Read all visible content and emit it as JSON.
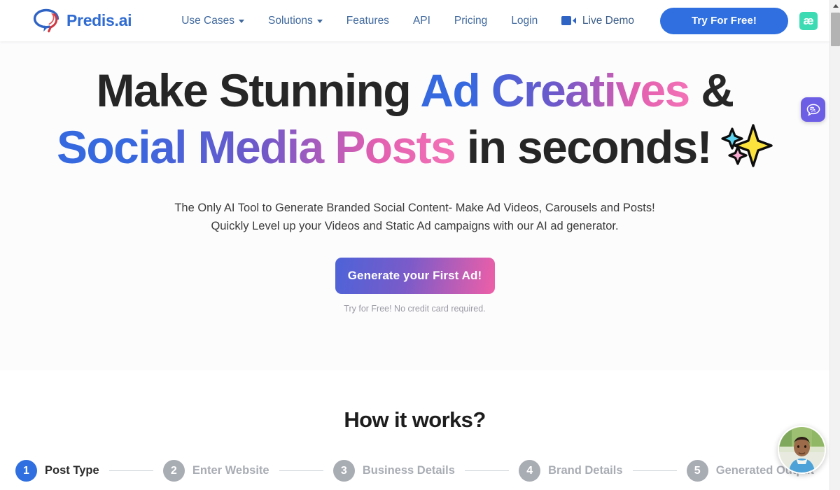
{
  "header": {
    "brand_name": "Predis.ai",
    "logo_icon": "predis-speech-bubble-logo",
    "nav": [
      {
        "label": "Use Cases",
        "has_caret": true
      },
      {
        "label": "Solutions",
        "has_caret": true
      },
      {
        "label": "Features",
        "has_caret": false
      },
      {
        "label": "API",
        "has_caret": false
      },
      {
        "label": "Pricing",
        "has_caret": false
      },
      {
        "label": "Login",
        "has_caret": false
      }
    ],
    "live_demo_label": "Live Demo",
    "live_demo_icon": "video-camera-icon",
    "try_free_label": "Try For Free!",
    "ae_badge_label": "æ"
  },
  "hero": {
    "headline_line1_plain": "Make Stunning ",
    "headline_line1_gradient": "Ad Creatives",
    "headline_line1_tail": " &",
    "headline_line2_gradient": "Social Media Posts",
    "headline_line2_plain": " in seconds!",
    "sparkle_icon": "sparkles-emoji",
    "subtitle_line1": "The Only AI Tool to Generate Branded Social Content- Make Ad Videos, Carousels and Posts!",
    "subtitle_line2": "Quickly Level up your Videos and Static Ad campaigns with our AI ad generator.",
    "cta_label": "Generate your First Ad!",
    "cta_note": "Try for Free! No credit card required."
  },
  "how_it_works": {
    "title": "How it works?",
    "steps": [
      {
        "number": "1",
        "label": "Post Type",
        "active": true
      },
      {
        "number": "2",
        "label": "Enter Website",
        "active": false
      },
      {
        "number": "3",
        "label": "Business Details",
        "active": false
      },
      {
        "number": "4",
        "label": "Brand Details",
        "active": false
      },
      {
        "number": "5",
        "label": "Generated Output",
        "active": false
      }
    ]
  },
  "widgets": {
    "chat_icon": "brain-chat-bubble-icon",
    "avatar_icon": "user-avatar-photo"
  },
  "colors": {
    "brand_blue": "#2f6bd1",
    "cta_blue": "#2f6fe0",
    "gradient_start": "#3668e0",
    "gradient_end": "#f472b6",
    "teal_badge": "#3ddbb4",
    "chat_purple": "#6d5ee6",
    "step_inactive": "#a8acb3"
  },
  "scrollbar": {
    "position": "top"
  }
}
